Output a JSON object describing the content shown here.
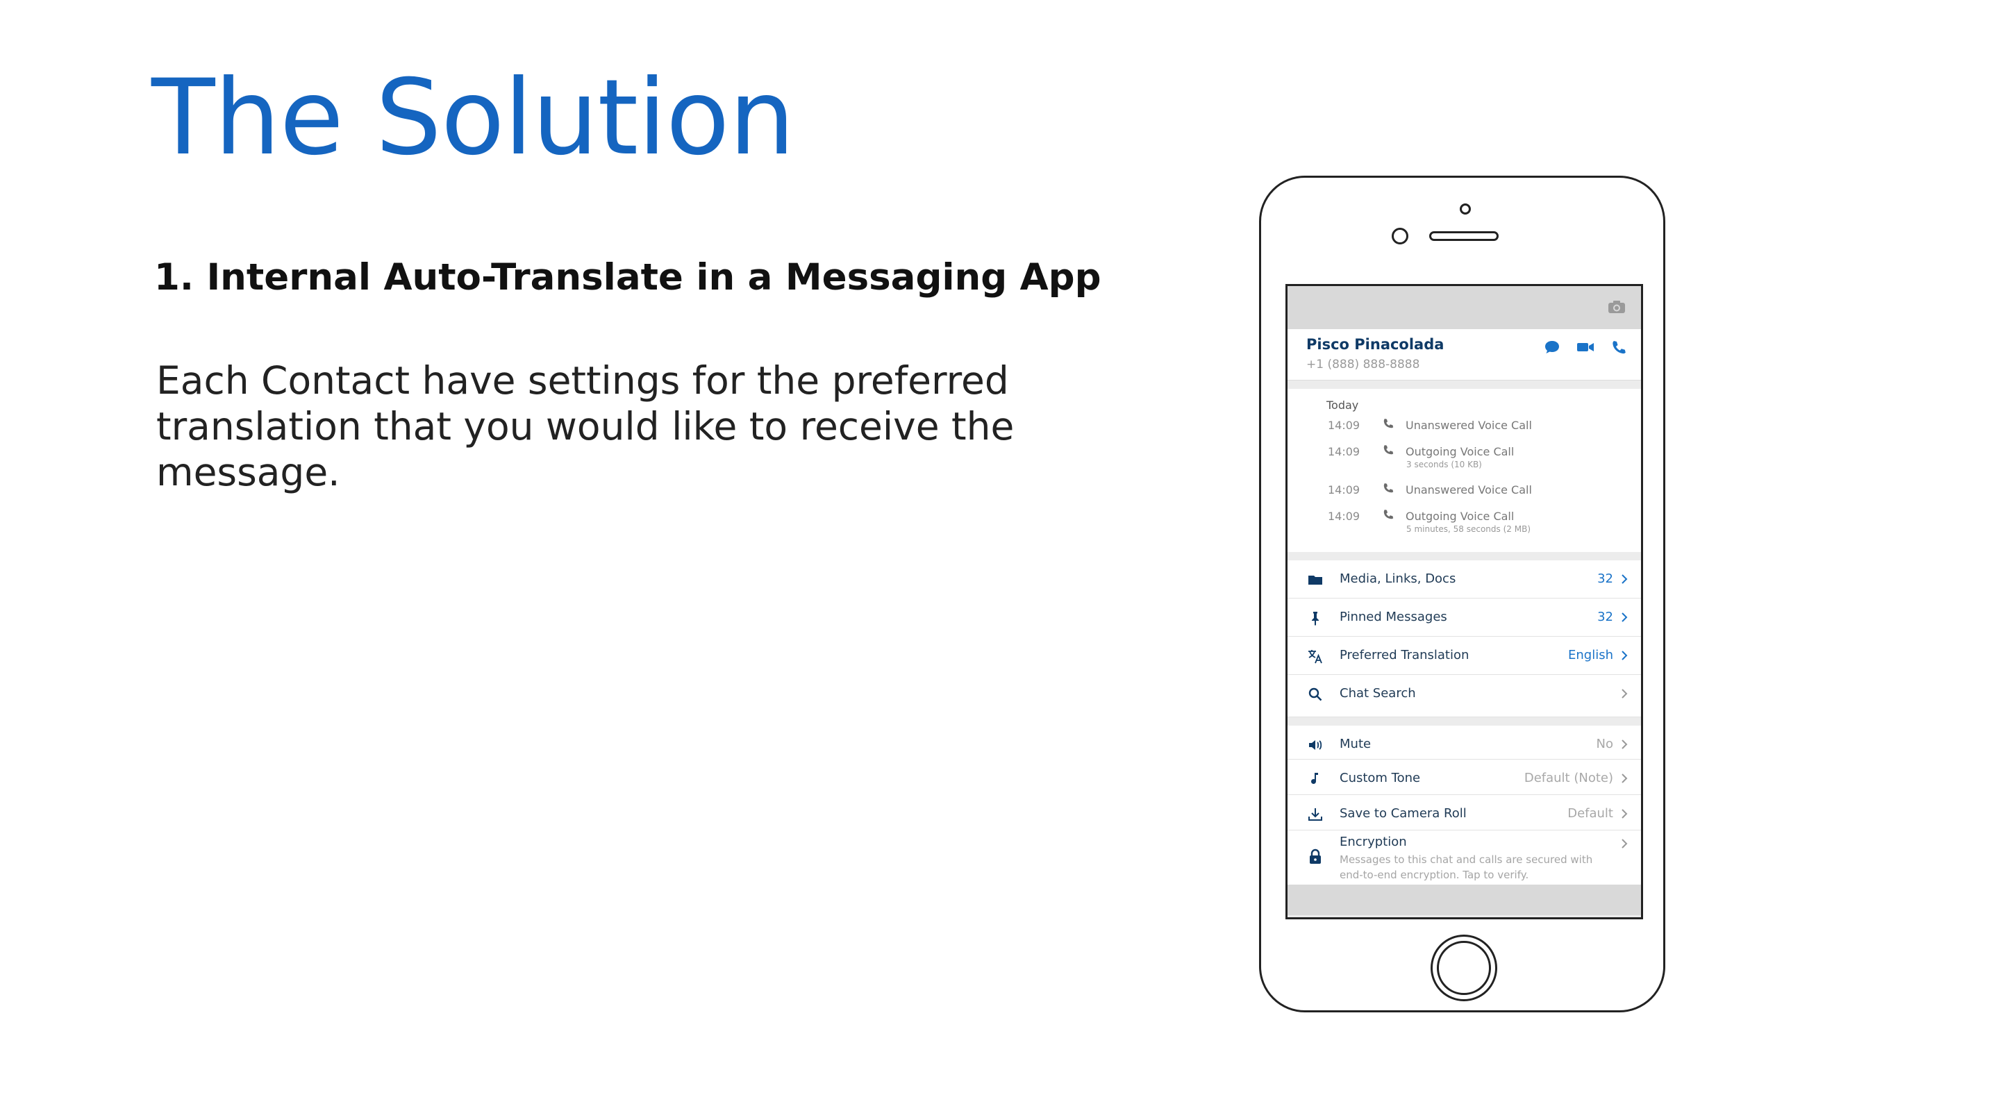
{
  "slide": {
    "title": "The Solution",
    "subtitle": "1. Internal Auto-Translate in a Messaging App",
    "body": "Each Contact have settings for the preferred translation that you would like to receive the message."
  },
  "colors": {
    "title_blue": "#1565c0",
    "accent_blue": "#1a73c8",
    "navy": "#0f3a66"
  },
  "contact": {
    "name": "Pisco Pinacolada",
    "phone": "+1 (888) 888-8888",
    "icons": [
      "chat-bubble-icon",
      "video-camera-icon",
      "phone-icon"
    ]
  },
  "calls": {
    "label": "Today",
    "items": [
      {
        "time": "14:09",
        "title": "Unanswered Voice Call",
        "detail": ""
      },
      {
        "time": "14:09",
        "title": "Outgoing Voice Call",
        "detail": "3 seconds (10 KB)"
      },
      {
        "time": "14:09",
        "title": "Unanswered Voice Call",
        "detail": ""
      },
      {
        "time": "14:09",
        "title": "Outgoing Voice Call",
        "detail": "5 minutes, 58 seconds (2 MB)"
      }
    ]
  },
  "settings": {
    "media": {
      "label": "Media, Links, Docs",
      "value": "32",
      "icon": "folder-icon"
    },
    "pinned": {
      "label": "Pinned Messages",
      "value": "32",
      "icon": "pin-icon"
    },
    "translation": {
      "label": "Preferred Translation",
      "value": "English",
      "icon": "translate-icon"
    },
    "search": {
      "label": "Chat Search",
      "value": "",
      "icon": "search-icon"
    },
    "mute": {
      "label": "Mute",
      "value": "No",
      "icon": "speaker-icon"
    },
    "tone": {
      "label": "Custom Tone",
      "value": "Default (Note)",
      "icon": "music-note-icon"
    },
    "camera_roll": {
      "label": "Save to Camera Roll",
      "value": "Default",
      "icon": "download-icon"
    },
    "encryption": {
      "label": "Encryption",
      "description": "Messages to this chat and calls are secured with end-to-end encryption. Tap to verify.",
      "icon": "lock-icon"
    }
  }
}
